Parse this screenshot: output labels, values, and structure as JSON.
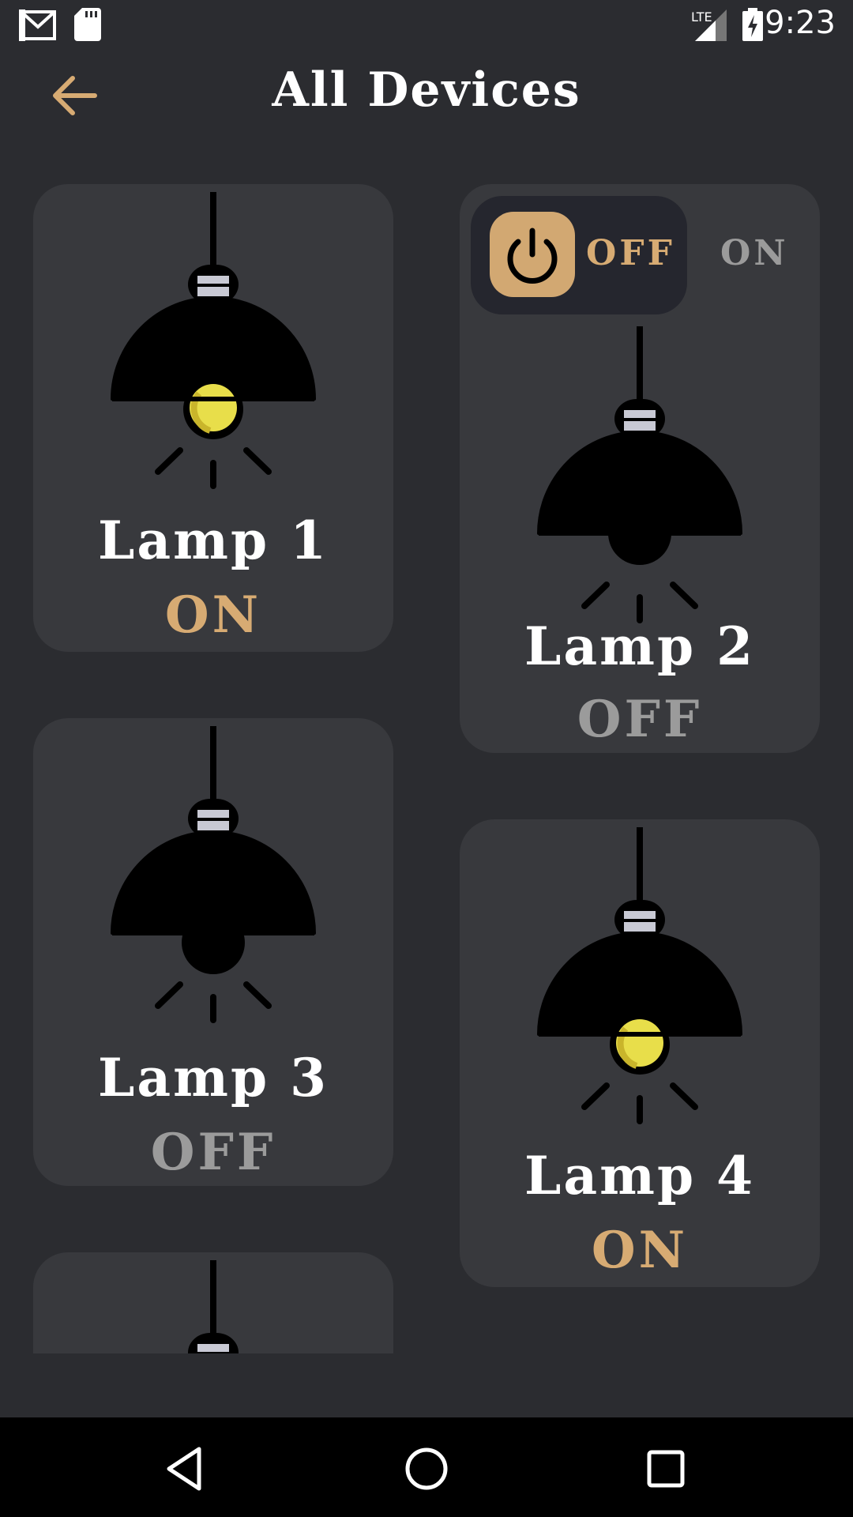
{
  "status_bar": {
    "time": "9:23",
    "network": "LTE",
    "icons": [
      "gmail-icon",
      "sd-card-icon",
      "signal-icon",
      "battery-charging-icon"
    ]
  },
  "app_bar": {
    "title": "All Devices",
    "back_icon": "arrow-left-icon"
  },
  "toggle": {
    "off_label": "OFF",
    "on_label": "ON",
    "selected": "OFF",
    "power_icon": "power-icon"
  },
  "devices": [
    {
      "name": "Lamp 1",
      "state": "ON"
    },
    {
      "name": "Lamp 2",
      "state": "OFF"
    },
    {
      "name": "Lamp 3",
      "state": "OFF"
    },
    {
      "name": "Lamp 4",
      "state": "ON"
    }
  ],
  "colors": {
    "background": "#2b2c30",
    "card": "#38393d",
    "accent": "#d7ab73",
    "off_text": "#9b9b9b",
    "bulb_on": "#e8de4a"
  },
  "nav_bar": {
    "icons": [
      "back-triangle-icon",
      "home-circle-icon",
      "recents-square-icon"
    ]
  }
}
